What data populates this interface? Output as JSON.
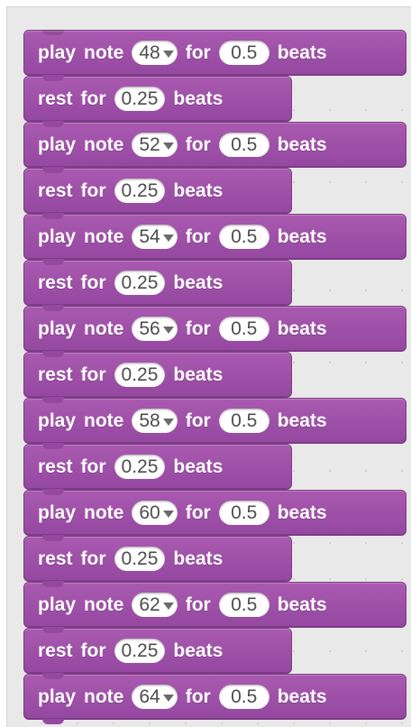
{
  "labels": {
    "play": "play",
    "note": "note",
    "for": "for",
    "beats": "beats",
    "rest": "rest"
  },
  "blocks": [
    {
      "type": "play",
      "note": "48",
      "beats": "0.5"
    },
    {
      "type": "rest",
      "beats": "0.25"
    },
    {
      "type": "play",
      "note": "52",
      "beats": "0.5"
    },
    {
      "type": "rest",
      "beats": "0.25"
    },
    {
      "type": "play",
      "note": "54",
      "beats": "0.5"
    },
    {
      "type": "rest",
      "beats": "0.25"
    },
    {
      "type": "play",
      "note": "56",
      "beats": "0.5"
    },
    {
      "type": "rest",
      "beats": "0.25"
    },
    {
      "type": "play",
      "note": "58",
      "beats": "0.5"
    },
    {
      "type": "rest",
      "beats": "0.25"
    },
    {
      "type": "play",
      "note": "60",
      "beats": "0.5"
    },
    {
      "type": "rest",
      "beats": "0.25"
    },
    {
      "type": "play",
      "note": "62",
      "beats": "0.5"
    },
    {
      "type": "rest",
      "beats": "0.25"
    },
    {
      "type": "play",
      "note": "64",
      "beats": "0.5"
    }
  ],
  "colors": {
    "block": "#9a4ca3",
    "workspace": "#e9e9e9"
  }
}
